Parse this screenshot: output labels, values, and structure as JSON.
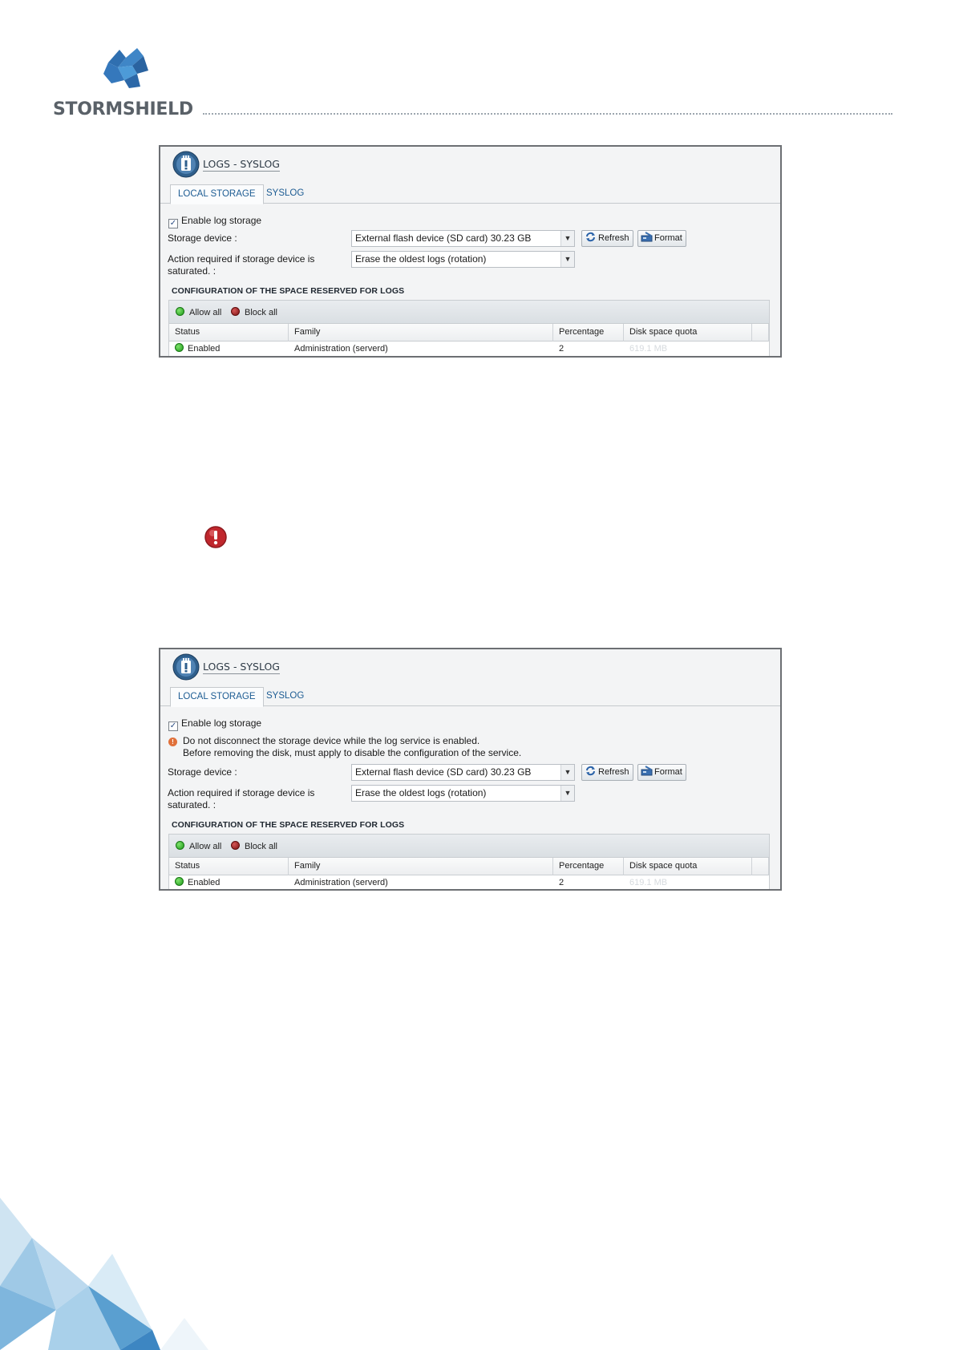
{
  "brand": {
    "name": "STORMSHIELD",
    "logo_icon": "stormshield-logo-icon"
  },
  "screens": [
    {
      "title": "LOGS - SYSLOG",
      "tabs": [
        "LOCAL STORAGE",
        "SYSLOG"
      ],
      "enable_label": "Enable log storage",
      "enable_checked": true,
      "storage_label": "Storage device :",
      "storage_value": "External flash device (SD card) 30.23 GB",
      "refresh_label": "Refresh",
      "format_label": "Format",
      "action_label_1": "Action required if storage device is",
      "action_label_2": "saturated. :",
      "action_value": "Erase the oldest logs (rotation)",
      "section_title": "CONFIGURATION OF THE SPACE RESERVED FOR LOGS",
      "allow_all": "Allow all",
      "block_all": "Block all",
      "columns": [
        "Status",
        "Family",
        "Percentage",
        "Disk space quota"
      ],
      "rows": [
        {
          "status": "Enabled",
          "family": "Administration (serverd)",
          "percentage": "2",
          "quota": "619.1 MB"
        }
      ]
    },
    {
      "title": "LOGS - SYSLOG",
      "tabs": [
        "LOCAL STORAGE",
        "SYSLOG"
      ],
      "enable_label": "Enable log storage",
      "enable_checked": true,
      "warning_line_1": "Do not disconnect the storage device while the log service is enabled.",
      "warning_line_2": "Before removing the disk, must apply to disable the configuration of the service.",
      "storage_label": "Storage device :",
      "storage_value": "External flash device (SD card) 30.23 GB",
      "refresh_label": "Refresh",
      "format_label": "Format",
      "action_label_1": "Action required if storage device is",
      "action_label_2": "saturated. :",
      "action_value": "Erase the oldest logs (rotation)",
      "section_title": "CONFIGURATION OF THE SPACE RESERVED FOR LOGS",
      "allow_all": "Allow all",
      "block_all": "Block all",
      "columns": [
        "Status",
        "Family",
        "Percentage",
        "Disk space quota"
      ],
      "rows": [
        {
          "status": "Enabled",
          "family": "Administration (serverd)",
          "percentage": "2",
          "quota": "619.1 MB"
        }
      ]
    }
  ],
  "middle_icon": "important-alert-icon",
  "colors": {
    "panel_border": "#6c6f73",
    "link_blue": "#1d5c93",
    "brand_gray": "#5a6168",
    "alert_red": "#c0272d"
  }
}
